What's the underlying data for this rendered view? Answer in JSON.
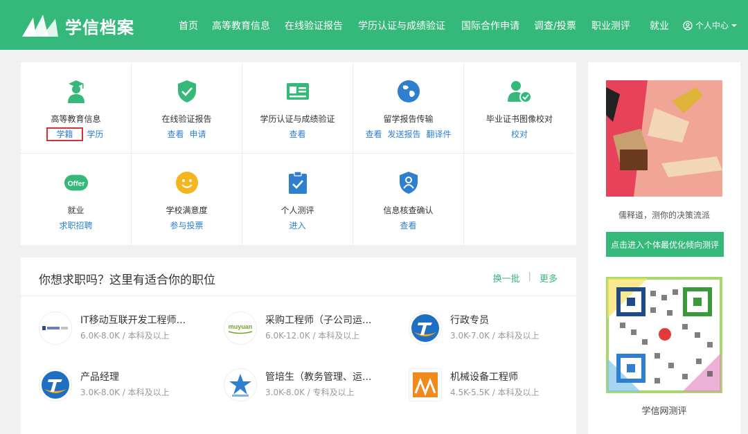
{
  "header": {
    "site_title": "学信档案",
    "nav": [
      {
        "label": "首页"
      },
      {
        "label": "高等教育信息"
      },
      {
        "label": "在线验证报告"
      },
      {
        "label": "学历认证与成绩验证"
      },
      {
        "label": "国际合作申请"
      },
      {
        "label": "调查/投票"
      },
      {
        "label": "职业测评"
      },
      {
        "label": "就业"
      }
    ],
    "user_center": "个人中心"
  },
  "services": [
    {
      "name": "高等教育信息",
      "icon": "graduate-icon",
      "links": [
        "学籍",
        "学历"
      ]
    },
    {
      "name": "在线验证报告",
      "icon": "shield-check-icon",
      "links": [
        "查看",
        "申请"
      ]
    },
    {
      "name": "学历认证与成绩验证",
      "icon": "id-card-icon",
      "links": [
        "查看"
      ]
    },
    {
      "name": "留学报告传输",
      "icon": "globe-icon",
      "links": [
        "查看",
        "发送报告",
        "翻译件"
      ]
    },
    {
      "name": "毕业证书图像校对",
      "icon": "user-check-icon",
      "links": [
        "校对"
      ]
    },
    {
      "name": "就业",
      "icon": "offer-icon",
      "icon_text": "Offer",
      "links": [
        "求职招聘"
      ]
    },
    {
      "name": "学校满意度",
      "icon": "smile-icon",
      "links": [
        "参与投票"
      ]
    },
    {
      "name": "个人测评",
      "icon": "clipboard-check-icon",
      "links": [
        "进入"
      ]
    },
    {
      "name": "信息核查确认",
      "icon": "shield-user-icon",
      "links": [
        "查看"
      ]
    }
  ],
  "jobs": {
    "title": "你想求职吗？这里有适合你的职位",
    "refresh": "换一批",
    "separator": "|",
    "more": "更多",
    "items": [
      {
        "name": "IT移动互联开发工程师...",
        "salary": "6.0K-8.0K",
        "edu": "本科及以上"
      },
      {
        "name": "采购工程师（子公司运...",
        "salary": "6.0K-12.0K",
        "edu": "本科及以上",
        "logo_text": "muyuan"
      },
      {
        "name": "行政专员",
        "salary": "3.0K-7.0K",
        "edu": "本科及以上"
      },
      {
        "name": "产品经理",
        "salary": "3.0K-8.0K",
        "edu": "本科及以上"
      },
      {
        "name": "管培生（教务管理、运...",
        "salary": "3.0K-8.0K",
        "edu": "专科及以上"
      },
      {
        "name": "机械设备工程师",
        "salary": "4.5K-5.5K",
        "edu": "本科及以上"
      }
    ],
    "meta_sep": " / "
  },
  "sidebar": {
    "ad_caption": "儒释道，测你的决策流派",
    "ad_button": "点击进入个体最优化倾向测评",
    "qr_caption": "学信网测评"
  },
  "colors": {
    "brand": "#34b97a",
    "link": "#2e7fd0",
    "highlight": "#d93030"
  }
}
